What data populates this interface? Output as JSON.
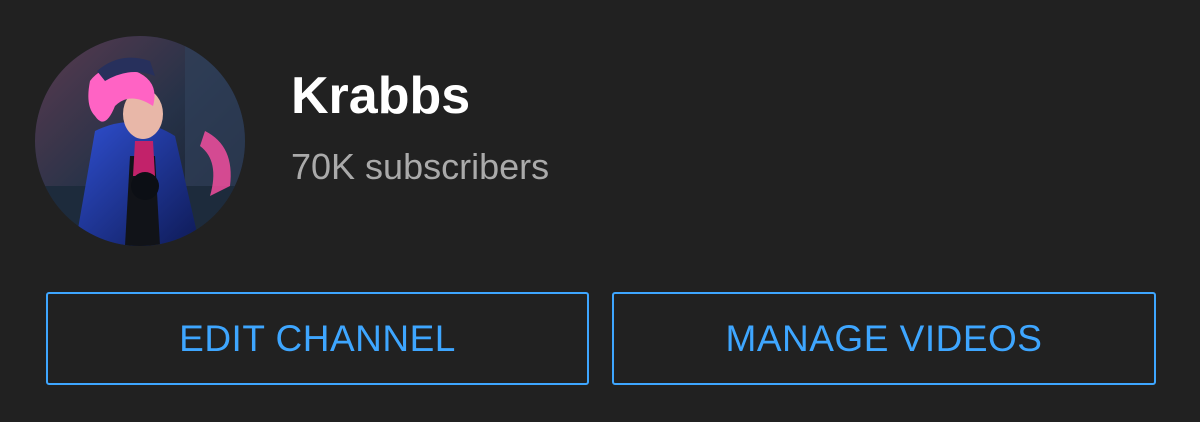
{
  "channel": {
    "name": "Krabbs",
    "subscribers": "70K subscribers",
    "avatar_icon": "channel-avatar"
  },
  "actions": {
    "edit_channel_label": "EDIT CHANNEL",
    "manage_videos_label": "MANAGE VIDEOS"
  },
  "colors": {
    "background": "#212121",
    "accent": "#3ea6ff",
    "title": "#ffffff",
    "subtitle": "#aaaaaa"
  }
}
